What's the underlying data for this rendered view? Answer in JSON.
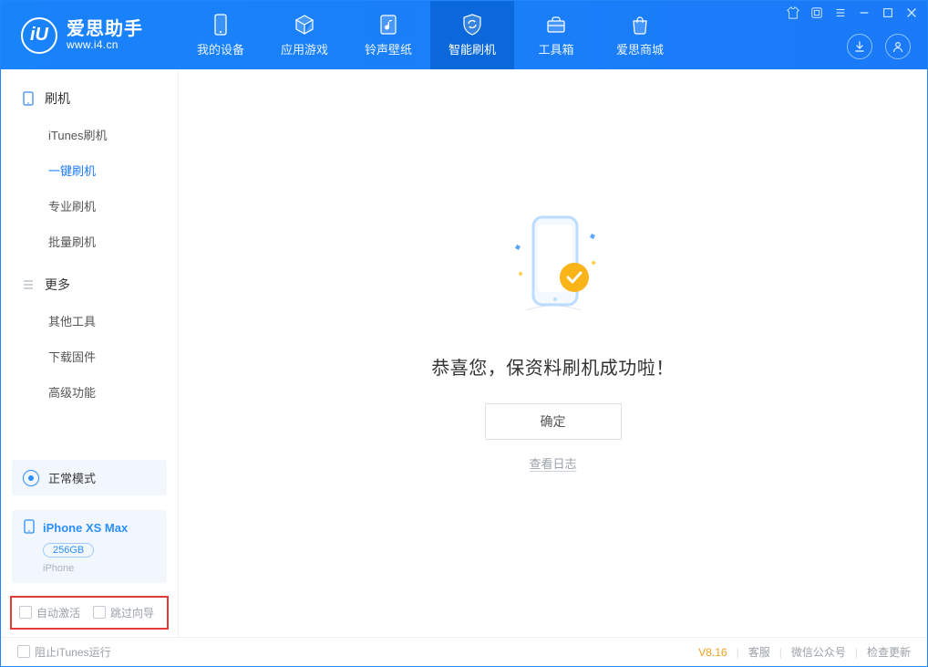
{
  "app": {
    "name": "爱思助手",
    "url": "www.i4.cn",
    "logo_letter": "iU"
  },
  "window_controls": {
    "tshirt": "tshirt-icon",
    "skin": "skin-icon",
    "menu": "menu-icon",
    "min": "minimize",
    "max": "maximize",
    "close": "close"
  },
  "nav": [
    {
      "label": "我的设备",
      "icon": "device-icon"
    },
    {
      "label": "应用游戏",
      "icon": "cube-icon"
    },
    {
      "label": "铃声壁纸",
      "icon": "music-icon"
    },
    {
      "label": "智能刷机",
      "icon": "refresh-shield-icon",
      "active": true
    },
    {
      "label": "工具箱",
      "icon": "toolbox-icon"
    },
    {
      "label": "爱思商城",
      "icon": "bag-icon"
    }
  ],
  "header_right": {
    "download": "download-icon",
    "user": "user-icon"
  },
  "sidebar": {
    "groups": [
      {
        "title": "刷机",
        "icon": "phone-icon",
        "items": [
          {
            "label": "iTunes刷机"
          },
          {
            "label": "一键刷机",
            "active": true
          },
          {
            "label": "专业刷机"
          },
          {
            "label": "批量刷机"
          }
        ]
      },
      {
        "title": "更多",
        "icon": "list-icon",
        "items": [
          {
            "label": "其他工具"
          },
          {
            "label": "下载固件"
          },
          {
            "label": "高级功能"
          }
        ]
      }
    ],
    "mode": {
      "label": "正常模式"
    },
    "device": {
      "name": "iPhone XS Max",
      "capacity": "256GB",
      "type": "iPhone"
    },
    "options": {
      "auto_activate": "自动激活",
      "skip_guide": "跳过向导"
    }
  },
  "main": {
    "title": "恭喜您，保资料刷机成功啦！",
    "ok": "确定",
    "view_log": "查看日志"
  },
  "footer": {
    "block_itunes": "阻止iTunes运行",
    "version": "V8.16",
    "links": [
      "客服",
      "微信公众号",
      "检查更新"
    ]
  }
}
